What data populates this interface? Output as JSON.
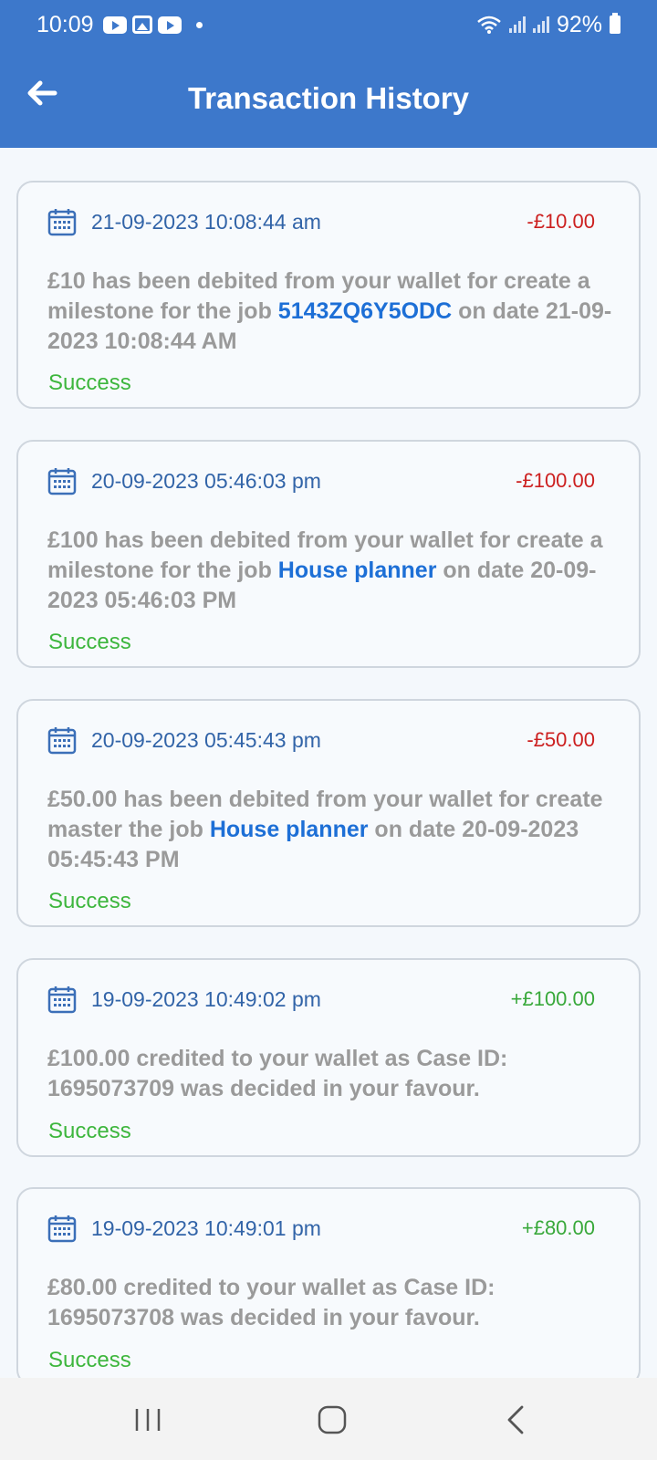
{
  "status_bar": {
    "time": "10:09",
    "battery": "92%",
    "notification_icons": [
      "youtube-icon",
      "gallery-icon",
      "youtube-icon",
      "dot-icon"
    ],
    "system_icons": [
      "wifi-icon",
      "signal-icon",
      "signal-icon",
      "battery-icon"
    ]
  },
  "header": {
    "title": "Transaction History",
    "background_color": "#3d78cb"
  },
  "transactions": [
    {
      "date": "21-09-2023 10:08:44 am",
      "amount": "-£10.00",
      "type": "debit",
      "desc_pre": "£10 has been debited from your wallet for create a milestone for the job ",
      "job": "5143ZQ6Y5ODC",
      "desc_post": " on date 21-09-2023 10:08:44 AM",
      "status": "Success"
    },
    {
      "date": "20-09-2023 05:46:03 pm",
      "amount": "-£100.00",
      "type": "debit",
      "desc_pre": "£100 has been debited from your wallet for create a milestone for the job ",
      "job": "House planner",
      "desc_post": " on date 20-09-2023 05:46:03 PM",
      "status": "Success"
    },
    {
      "date": "20-09-2023 05:45:43 pm",
      "amount": "-£50.00",
      "type": "debit",
      "desc_pre": "£50.00 has been debited from your wallet for create master the job ",
      "job": "House planner",
      "desc_post": " on date 20-09-2023 05:45:43 PM",
      "status": "Success"
    },
    {
      "date": "19-09-2023 10:49:02 pm",
      "amount": "+£100.00",
      "type": "credit",
      "desc_pre": "£100.00 credited to your wallet as Case ID: 1695073709 was decided in your favour.",
      "job": "",
      "desc_post": "",
      "status": "Success"
    },
    {
      "date": "19-09-2023 10:49:01 pm",
      "amount": "+£80.00",
      "type": "credit",
      "desc_pre": "£80.00 credited to your wallet as Case ID: 1695073708 was decided in your favour.",
      "job": "",
      "desc_post": "",
      "status": "Success"
    }
  ],
  "colors": {
    "debit": "#cc1f1f",
    "credit": "#38a83a",
    "success": "#3db63d",
    "job_link": "#1d6fd6",
    "date": "#3264a8"
  },
  "nav": {
    "recents": "recents-icon",
    "home": "home-icon",
    "back": "back-nav-icon"
  }
}
